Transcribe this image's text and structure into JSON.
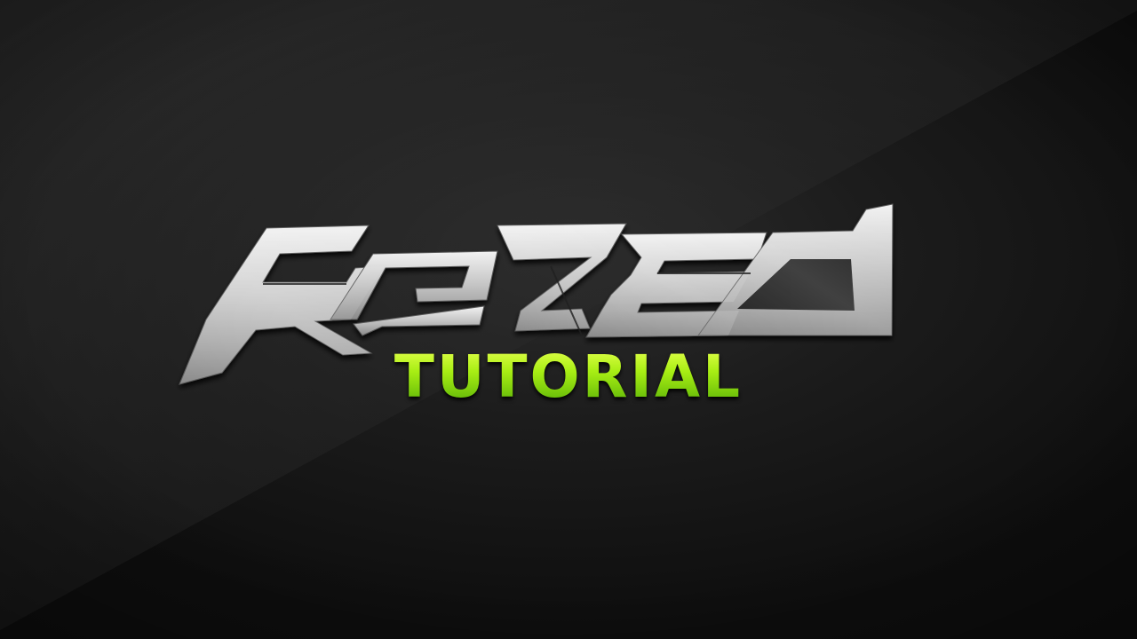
{
  "thumbnail": {
    "logo_text": "RAZED",
    "subtitle": "TUTORIAL",
    "colors": {
      "background": "#141414",
      "logo_metal": "#c8c8c8",
      "subtitle_top": "#e2ff4a",
      "subtitle_bottom": "#58b106"
    }
  }
}
